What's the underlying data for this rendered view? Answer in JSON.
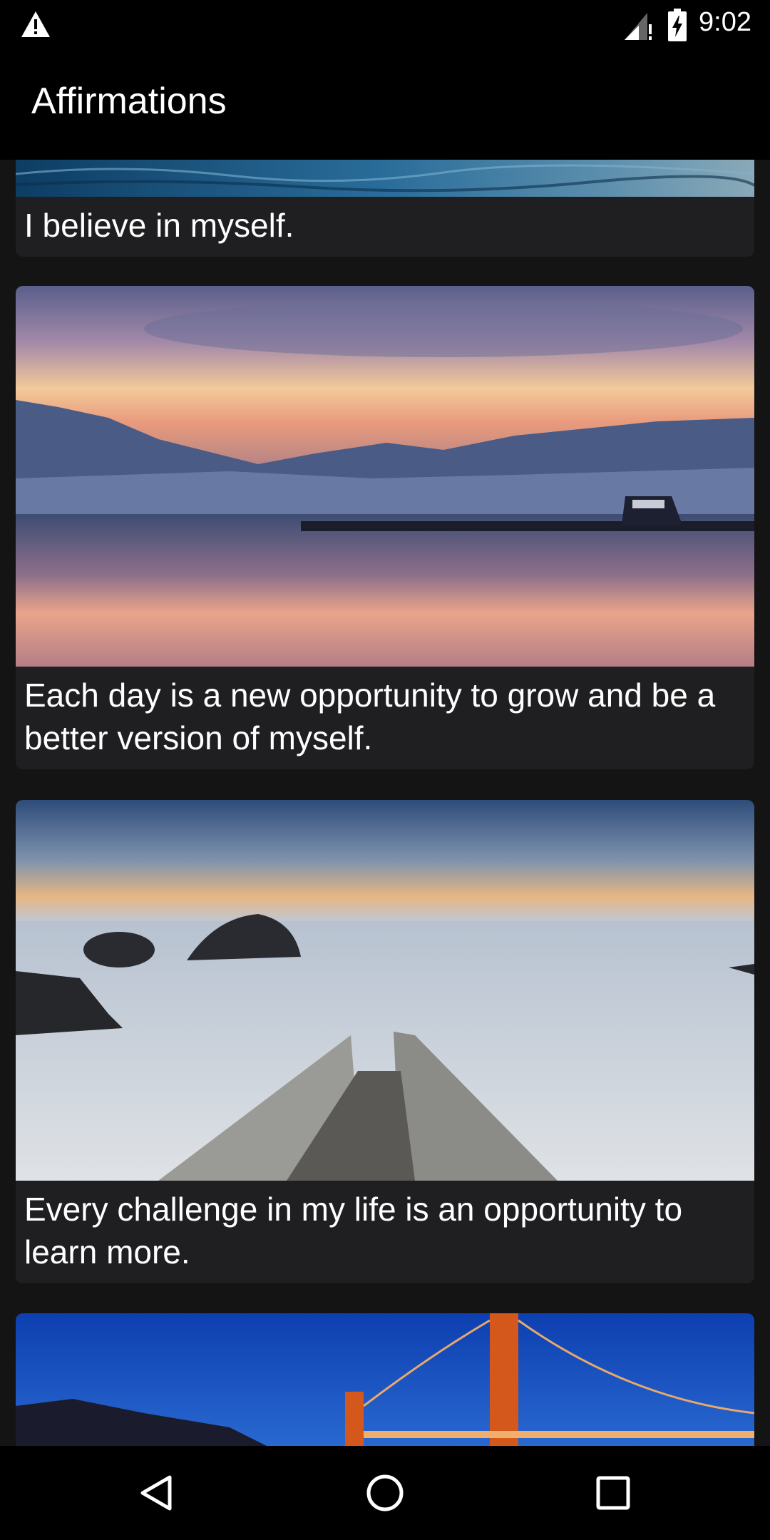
{
  "status_bar": {
    "time": "9:02",
    "icons": [
      "warning-icon",
      "signal-icon",
      "battery-charging-icon"
    ]
  },
  "app_bar": {
    "title": "Affirmations"
  },
  "cards": [
    {
      "caption": "I believe in myself.",
      "image": "ocean-water-photo"
    },
    {
      "caption": "Each day is a new opportunity to grow and be a better version of myself.",
      "image": "lake-sunset-mountains-photo"
    },
    {
      "caption": "Every challenge in my life is an opportunity to learn more.",
      "image": "rocky-coast-pier-photo"
    },
    {
      "caption": "",
      "image": "golden-gate-bridge-night-photo"
    }
  ],
  "nav_bar": {
    "buttons": [
      "back-icon",
      "home-icon",
      "recents-icon"
    ]
  }
}
